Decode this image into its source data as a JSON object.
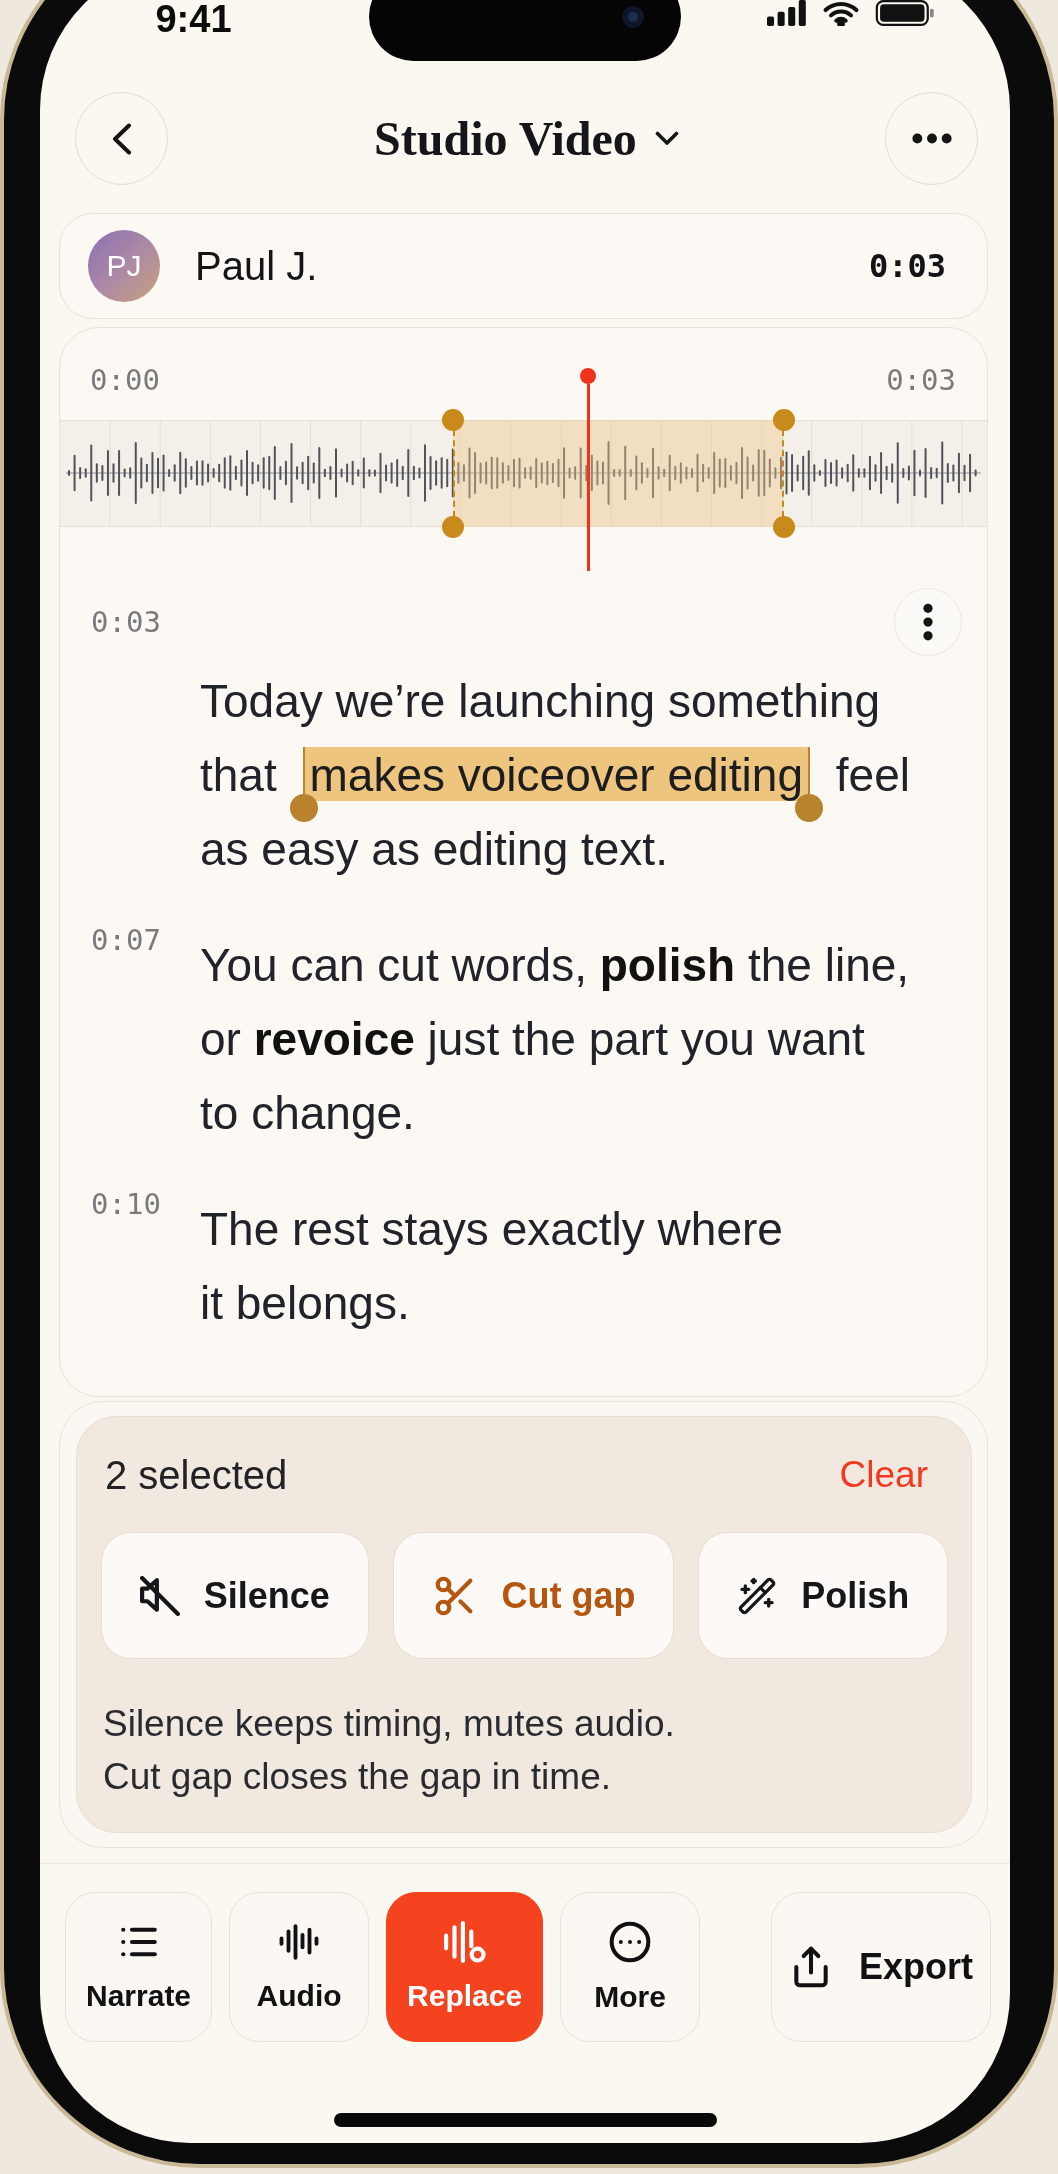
{
  "status_bar": {
    "time": "9:41"
  },
  "header": {
    "title": "Studio Video"
  },
  "speaker": {
    "initials": "PJ",
    "name": "Paul J.",
    "duration": "0:03"
  },
  "waveform": {
    "start_label": "0:00",
    "end_label": "0:03"
  },
  "segments": [
    {
      "timestamp": "0:03",
      "menu": true,
      "runs": [
        {
          "text": "Today we’re launching something\nthat ",
          "selected": false
        },
        {
          "text": "makes voiceover editing",
          "selected": true
        },
        {
          "text": " feel\nas easy as editing text.",
          "selected": false
        }
      ]
    },
    {
      "timestamp": "0:07",
      "menu": false,
      "runs": [
        {
          "text": "You can cut words, **polish** the line,\nor **revoice** just the part you want\nto change.",
          "selected": false
        }
      ]
    },
    {
      "timestamp": "0:10",
      "menu": false,
      "runs": [
        {
          "text": "The rest stays exactly where\nit belongs.",
          "selected": false
        }
      ]
    }
  ],
  "selection_panel": {
    "count": "2 selected",
    "clear": "Clear",
    "actions": [
      {
        "kind": "silence",
        "label": "Silence",
        "selected": false
      },
      {
        "kind": "cut",
        "label": "Cut gap",
        "selected": true
      },
      {
        "kind": "polish",
        "label": "Polish",
        "selected": false
      }
    ],
    "hint": "Silence keeps timing, mutes audio.\nCut gap closes the gap in time."
  },
  "toolbar": {
    "tools": [
      {
        "kind": "narrate",
        "label": "Narrate",
        "selected": false
      },
      {
        "kind": "audio",
        "label": "Audio",
        "selected": false
      },
      {
        "kind": "replace",
        "label": "Replace",
        "selected": true
      },
      {
        "kind": "more",
        "label": "More",
        "selected": false
      }
    ],
    "export": "Export"
  }
}
